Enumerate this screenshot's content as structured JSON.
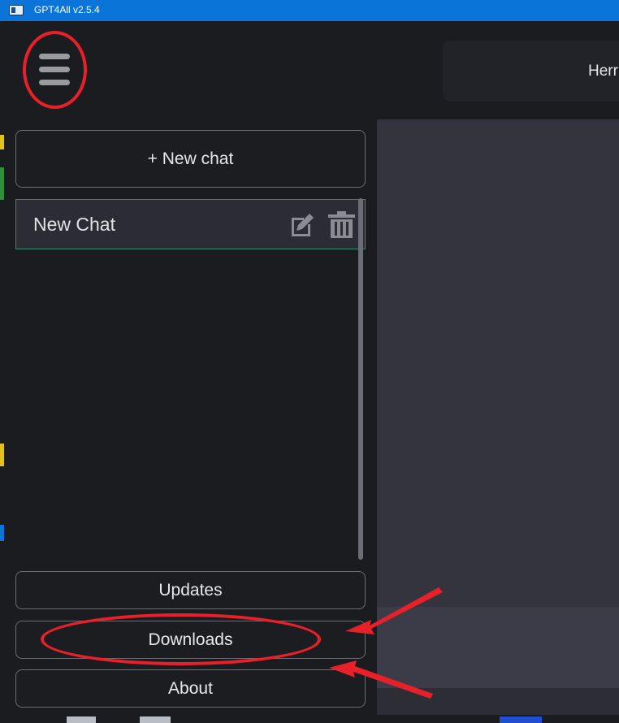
{
  "window": {
    "title": "GPT4All v2.5.4"
  },
  "header": {
    "partial_text": "Herr"
  },
  "sidebar": {
    "new_chat_label": "+ New chat",
    "chats": [
      {
        "label": "New Chat"
      }
    ],
    "bottom_buttons": [
      {
        "label": "Updates"
      },
      {
        "label": "Downloads"
      },
      {
        "label": "About"
      }
    ]
  },
  "icons": {
    "menu": "hamburger-menu-icon",
    "edit": "edit-icon",
    "delete": "trash-icon"
  },
  "colors": {
    "titlebar": "#0a74d8",
    "sidebar_bg": "#1b1c20",
    "selected_chat_border": "#2f8f6a",
    "content_bg": "#33343e",
    "annotation_red": "#e8202a"
  }
}
